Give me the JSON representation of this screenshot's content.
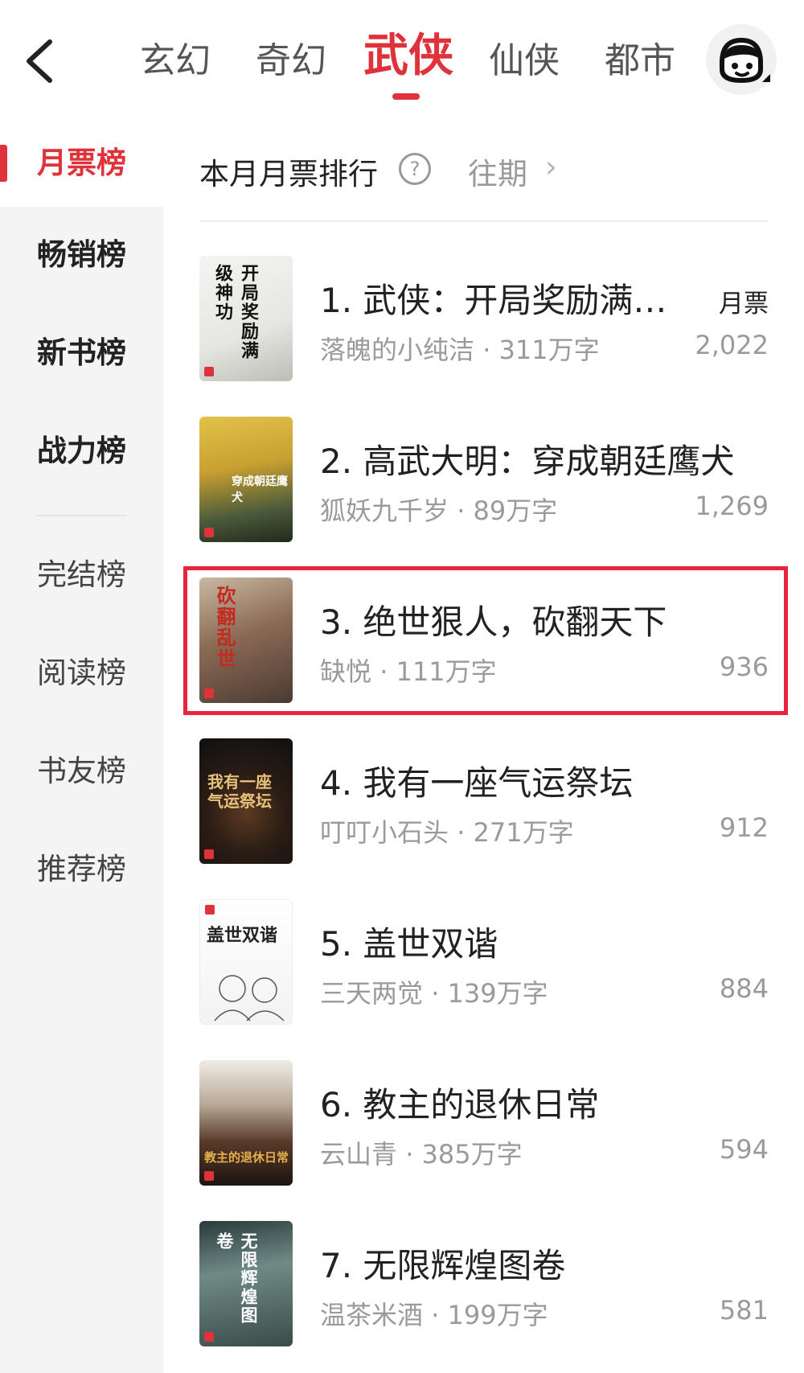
{
  "nav": {
    "tabs": [
      {
        "label": "玄幻"
      },
      {
        "label": "奇幻"
      },
      {
        "label": "武侠"
      },
      {
        "label": "仙侠"
      },
      {
        "label": "都市"
      }
    ],
    "active_tab": "武侠"
  },
  "sidebar": {
    "items": [
      {
        "label": "月票榜"
      },
      {
        "label": "畅销榜"
      },
      {
        "label": "新书榜"
      },
      {
        "label": "战力榜"
      },
      {
        "label": "完结榜"
      },
      {
        "label": "阅读榜"
      },
      {
        "label": "书友榜"
      },
      {
        "label": "推荐榜"
      }
    ]
  },
  "main": {
    "title": "本月月票排行",
    "past_label": "往期",
    "votes_label": "月票"
  },
  "books": [
    {
      "title": "1. 武侠：开局奖励满…",
      "author": "落魄的小纯洁",
      "words": "311万字",
      "votes": "2,022",
      "cover_text": "开局奖励满级神功"
    },
    {
      "title": "2. 高武大明：穿成朝廷鹰犬",
      "author": "狐妖九千岁",
      "words": "89万字",
      "votes": "1,269",
      "cover_text": "穿成朝廷鹰犬"
    },
    {
      "title": "3. 绝世狠人，砍翻天下",
      "author": "缺悦",
      "words": "111万字",
      "votes": "936",
      "cover_text": "砍翻乱世"
    },
    {
      "title": "4. 我有一座气运祭坛",
      "author": "叮叮小石头",
      "words": "271万字",
      "votes": "912",
      "cover_text": "我有一座气运祭坛"
    },
    {
      "title": "5. 盖世双谐",
      "author": "三天两觉",
      "words": "139万字",
      "votes": "884",
      "cover_text": "盖世双谐"
    },
    {
      "title": "6. 教主的退休日常",
      "author": "云山青",
      "words": "385万字",
      "votes": "594",
      "cover_text": "教主的退休日常"
    },
    {
      "title": "7. 无限辉煌图卷",
      "author": "温茶米酒",
      "words": "199万字",
      "votes": "581",
      "cover_text": "无限辉煌图卷"
    }
  ],
  "colors": {
    "accent": "#e0323a",
    "highlight": "#e8253d",
    "sidebar_bg": "#f4f4f4"
  },
  "icons": {
    "back": "chevron-left-icon",
    "avatar": "user-avatar-icon",
    "help": "question-circle-icon",
    "chevron": "chevron-right-icon"
  }
}
